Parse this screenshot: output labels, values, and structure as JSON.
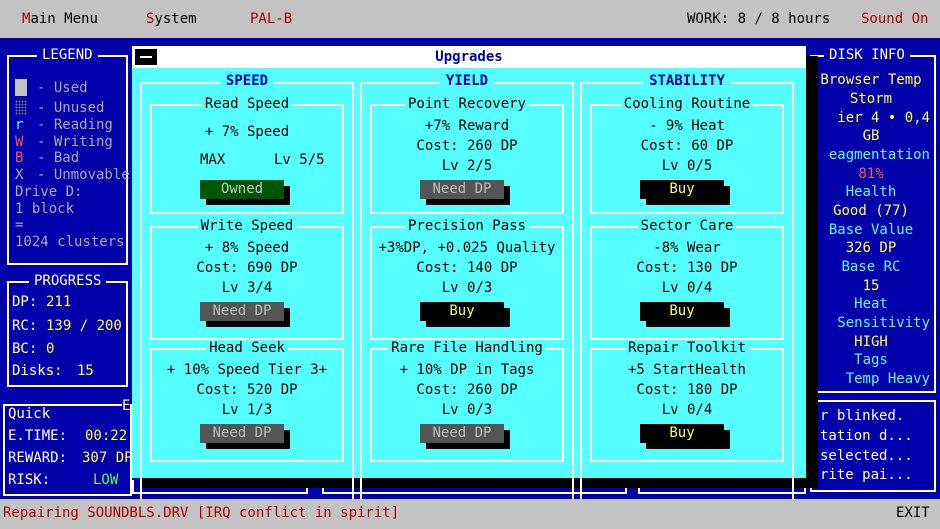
{
  "menu": {
    "main_menu_hot": "M",
    "main_menu_rest": "ain Menu",
    "system_hot": "S",
    "system_rest": "ystem",
    "palb": "PAL-B",
    "work": "WORK: 8 / 8 hours",
    "sound": "Sound On"
  },
  "legend": {
    "title": "LEGEND",
    "used": "- Used",
    "unused": "- Unused",
    "reading_key": "r",
    "reading": "- Reading",
    "writing_key": "W",
    "writing": "- Writing",
    "bad_key": "B",
    "bad": "- Bad",
    "unmovable_key": "X",
    "unmovable": "- Unmovable",
    "drive": "Drive D:",
    "block": "1 block",
    "eq": "=",
    "clusters": "1024 clusters"
  },
  "progress": {
    "title": "PROGRESS",
    "dp_label": "DP:",
    "dp": "211",
    "rc_label": "RC:",
    "rc": "139 / 200",
    "bc_label": "BC:",
    "bc": "0",
    "disks_label": "Disks:",
    "disks": "15"
  },
  "quick": {
    "title": "Quick",
    "title_tail": "E",
    "etime_label": "E.TIME:",
    "etime": "00:22",
    "reward_label": "REWARD:",
    "reward": "307 DP",
    "risk_label": "RISK:",
    "risk": "LOW"
  },
  "diskinfo": {
    "title": "DISK INFO",
    "lines": [
      "Browser Temp",
      "Storm",
      "ier 4 • 0,4",
      "GB",
      "eagmentation",
      "81%",
      "Health",
      "Good (77)",
      "Base Value",
      "326 DP",
      "Base RC",
      "15",
      "Heat",
      "Sensitivity",
      "HIGH",
      "Tags",
      "Temp Heavy"
    ]
  },
  "log": [
    "r blinked.",
    "tation d...",
    "selected...",
    "rite pai..."
  ],
  "status": {
    "message": "Repairing SOUNDBLS.DRV [IRQ conflict in spirit]",
    "exit": "EXIT"
  },
  "dialog": {
    "title": "Upgrades",
    "columns": [
      {
        "name": "SPEED",
        "cards": [
          {
            "title": "Read Speed",
            "effect": "+ 7% Speed",
            "max": "MAX",
            "level": "Lv 5/5",
            "button": "Owned"
          },
          {
            "title": "Write Speed",
            "effect": "+ 8% Speed",
            "cost": "Cost: 690 DP",
            "level": "Lv 3/4",
            "button": "Need DP"
          },
          {
            "title": "Head Seek",
            "effect": "+ 10% Speed Tier 3+",
            "cost": "Cost: 520 DP",
            "level": "Lv 1/3",
            "button": "Need DP"
          }
        ]
      },
      {
        "name": "YIELD",
        "cards": [
          {
            "title": "Point Recovery",
            "effect": "+7% Reward",
            "cost": "Cost: 260 DP",
            "level": "Lv 2/5",
            "button": "Need DP"
          },
          {
            "title": "Precision Pass",
            "effect": "+3%DP, +0.025 Quality",
            "cost": "Cost: 140 DP",
            "level": "Lv 0/3",
            "button": "Buy"
          },
          {
            "title": "Rare File Handling",
            "effect": "+ 10% DP in Tags",
            "cost": "Cost: 260 DP",
            "level": "Lv 0/3",
            "button": "Need DP"
          }
        ]
      },
      {
        "name": "STABILITY",
        "cards": [
          {
            "title": "Cooling Routine",
            "effect": "- 9% Heat",
            "cost": "Cost: 60 DP",
            "level": "Lv 0/5",
            "button": "Buy"
          },
          {
            "title": "Sector Care",
            "effect": "-8% Wear",
            "cost": "Cost: 130 DP",
            "level": "Lv 0/4",
            "button": "Buy"
          },
          {
            "title": "Repair Toolkit",
            "effect": "+5 StartHealth",
            "cost": "Cost: 180 DP",
            "level": "Lv 0/4",
            "button": "Buy"
          }
        ]
      }
    ]
  },
  "colors": {
    "screen": "#0000aa",
    "dialog": "#55ffff",
    "menubar": "#c3c3c3",
    "accent_red": "#aa0000",
    "buy_text": "#ffff55"
  }
}
